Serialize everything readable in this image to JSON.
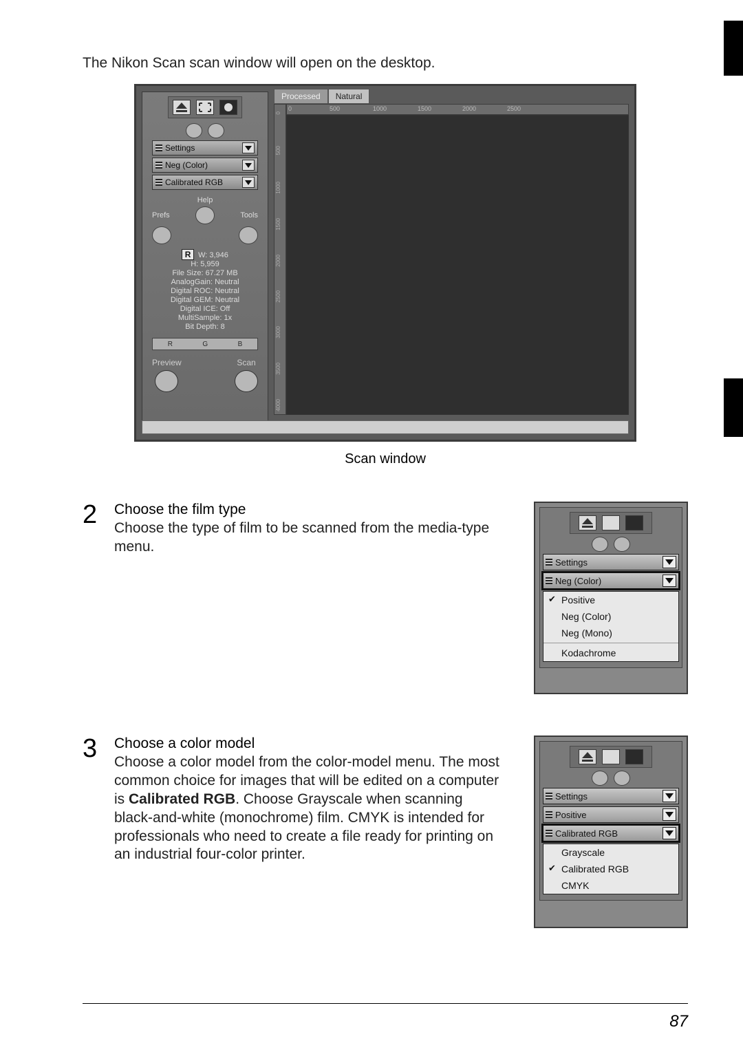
{
  "intro": "The Nikon Scan scan window will open on the desktop.",
  "scanwin": {
    "tabs": {
      "processed": "Processed",
      "natural": "Natural"
    },
    "ruler_h": [
      "0",
      "500",
      "1000",
      "1500",
      "2000",
      "2500"
    ],
    "ruler_v": [
      "0",
      "500",
      "1000",
      "1500",
      "2000",
      "2500",
      "3000",
      "3500",
      "4000"
    ],
    "drops": {
      "settings": "Settings",
      "film": "Neg (Color)",
      "color": "Calibrated RGB"
    },
    "controls": {
      "help": "Help",
      "prefs": "Prefs",
      "tools": "Tools"
    },
    "info": {
      "rchip": "R",
      "w": "W: 3,946",
      "h": "H: 5,959",
      "filesize": "File Size: 67.27 MB",
      "analoggain": "AnalogGain: Neutral",
      "roc": "Digital ROC: Neutral",
      "gem": "Digital GEM: Neutral",
      "ice": "Digital ICE: Off",
      "multisample": "MultiSample: 1x",
      "bitdepth": "Bit Depth: 8"
    },
    "rgb": {
      "r": "R",
      "g": "G",
      "b": "B"
    },
    "buttons": {
      "preview": "Preview",
      "scan": "Scan"
    }
  },
  "caption": "Scan window",
  "step2": {
    "num": "2",
    "title": "Choose the film type",
    "text": "Choose the type of film to be scanned from the media-type menu.",
    "thumb_drops": {
      "settings": "Settings",
      "film": "Neg (Color)"
    },
    "menu": [
      {
        "label": "Positive",
        "checked": true
      },
      {
        "label": "Neg (Color)",
        "checked": false
      },
      {
        "label": "Neg (Mono)",
        "checked": false
      }
    ],
    "menu2": "Kodachrome"
  },
  "step3": {
    "num": "3",
    "title": "Choose a color model",
    "text_parts": [
      "Choose a color model from the color-model menu.  The most common choice for images that will be edited on a computer is ",
      "Calibrated RGB",
      ".  Choose Grayscale when scanning black-and-white (monochrome) film.  CMYK is intended for professionals who need to create a file ready for printing on an industrial four-color printer."
    ],
    "thumb_drops": {
      "settings": "Settings",
      "film": "Positive",
      "color": "Calibrated RGB"
    },
    "menu": [
      {
        "label": "Grayscale",
        "checked": false
      },
      {
        "label": "Calibrated RGB",
        "checked": true
      },
      {
        "label": "CMYK",
        "checked": false
      }
    ]
  },
  "pagenum": "87"
}
